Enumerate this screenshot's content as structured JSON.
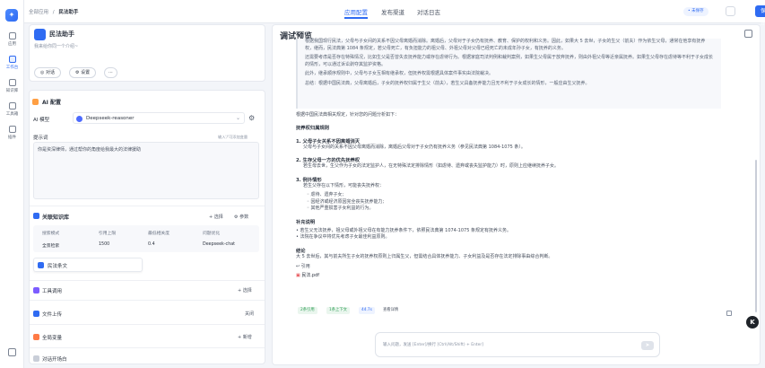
{
  "topbar": {
    "breadcrumb_parent": "全部应用",
    "breadcrumb_current": "民法助手",
    "tabs": [
      "应用配置",
      "发布渠道",
      "对话日志"
    ],
    "saved_label": "• 未保存",
    "publish_label": "保存"
  },
  "rail": {
    "items": [
      "应用",
      "工作台",
      "知识库",
      "工具箱",
      "插件"
    ]
  },
  "app": {
    "name": "民法助手",
    "desc": "我来给你同一个介绍~",
    "chat_btn": "对话",
    "settings_btn": "设置",
    "more_btn": "···"
  },
  "ai_config": {
    "heading": "AI 配置",
    "model_label": "AI 模型",
    "model_value": "Deepseek-reasoner",
    "prompt_label": "提示词",
    "prompt_hint": "输入'/'可添加变量",
    "prompt_value": "你是资深律师，通过帮你的角度给我最大的法律援助"
  },
  "knowledge": {
    "heading": "关联知识库",
    "select_label": "+ 选择",
    "params_label": "参数",
    "columns": [
      "搜索模式",
      "引用上限",
      "最低相关度",
      "问题优化"
    ],
    "row": [
      "全景检索",
      "1500",
      "0.4",
      "Deepseek-chat"
    ],
    "dataset_chip": "民法条文"
  },
  "tools": {
    "heading": "工具调用",
    "action": "+ 选择"
  },
  "file_upload": {
    "heading": "文件上传",
    "value": "关闭"
  },
  "global_vars": {
    "heading": "全局变量",
    "action": "+ 新增"
  },
  "opening": {
    "heading": "对话开场白"
  },
  "preview": {
    "title": "调试预览",
    "para1": "根据我国现行民法，父母与子女间的关系不因父母离婚而消除。离婚后，父母对于子女仍有抚养、教育、保护的权利和义务。因此，如果大 5 去世，子女的生父（前夫）作为依生父母，通常在他享有抚养权，继而，民法典第 1084 条规定，若父母死亡，有负担能力的祖父母、外祖父母对父母已经死亡的未成年孙子女，有抚养的义务。",
    "para2": "还需要考虑是否存在特殊情况，比如生父是否曾失去抚养能力或存在虐待行为。根据家庭司法判例和裁判案例，如果生父母属于放弃抚养，则由外祖父母等近亲属抚养。如果生父母存在虐待等不利于子女成长的情形，可以通过诉讼剥夺其监护资格。",
    "para3": "此外，继承顺序规则中，父母与子女互相有继承权，但抚养权需根据具体案件事实由法院裁决。",
    "para4": "总结：根据中国民法典，父母离婚后，子女的抚养权归属于生父（前夫），若生父具备抚养能力且无不利于子女成长的情形，一般应由生父抚养。",
    "intro": "根据中国民法典相关规定，针对您的问题分析如下：",
    "section1_title": "抚养权归属规则",
    "s1_item1_title": "1. 父母子女关系不因离婚消灭",
    "s1_item1_text": "父母与子女间的关系不因父母离婚而消除，离婚后父母对于子女仍有抚养义务（参见民法典第 1084-1075 条）。",
    "s1_item2_title": "2. 生存父母一方的优先抚养权",
    "s1_item2_text": "若生母去世，生父作为子女的法定监护人，在无特殊法定排除情形（如虐待、遗弃或丧失监护能力）时，原则上应继续抚养子女。",
    "s1_item3_title": "3. 例外情形",
    "s1_item3_text": "若生父存在以下情形，可能丧失抚养权：",
    "s1_bullets": [
      "虐待、遗弃子女;",
      "因经济或经济原因完全丧失抚养能力;",
      "其他严重损害子女利益的行为。"
    ],
    "section2_title": "补充说明",
    "s2_bullets": [
      "若生父无法抚养，祖父母或外祖父母在有能力抚养条件下，依照民法典第 1074-1075 条规定有抚养义务。",
      "法院在争议中将优先考虑子女最佳利益原则。"
    ],
    "conclusion_title": "结论",
    "conclusion_text": "大 5 去世后，其与前夫所生子女的抚养权原则上归属生父，但需结合具体抚养能力、子女利益及是否存在法定排除事由综合判断。",
    "quote_label": "引用",
    "file_name": "民法.pdf",
    "tags": [
      "2条引用",
      "1条上下文",
      "44.7s",
      "查看详情"
    ],
    "input_placeholder": "输入问题，发送 [Enter]/换行 [Ctrl(Alt/Shift) + Enter]",
    "send_glyph": "➤",
    "floating_btn": "K"
  },
  "colors": {
    "accent": "#2f6bf2",
    "background": "#f3f5f9",
    "panel": "#ffffff"
  }
}
